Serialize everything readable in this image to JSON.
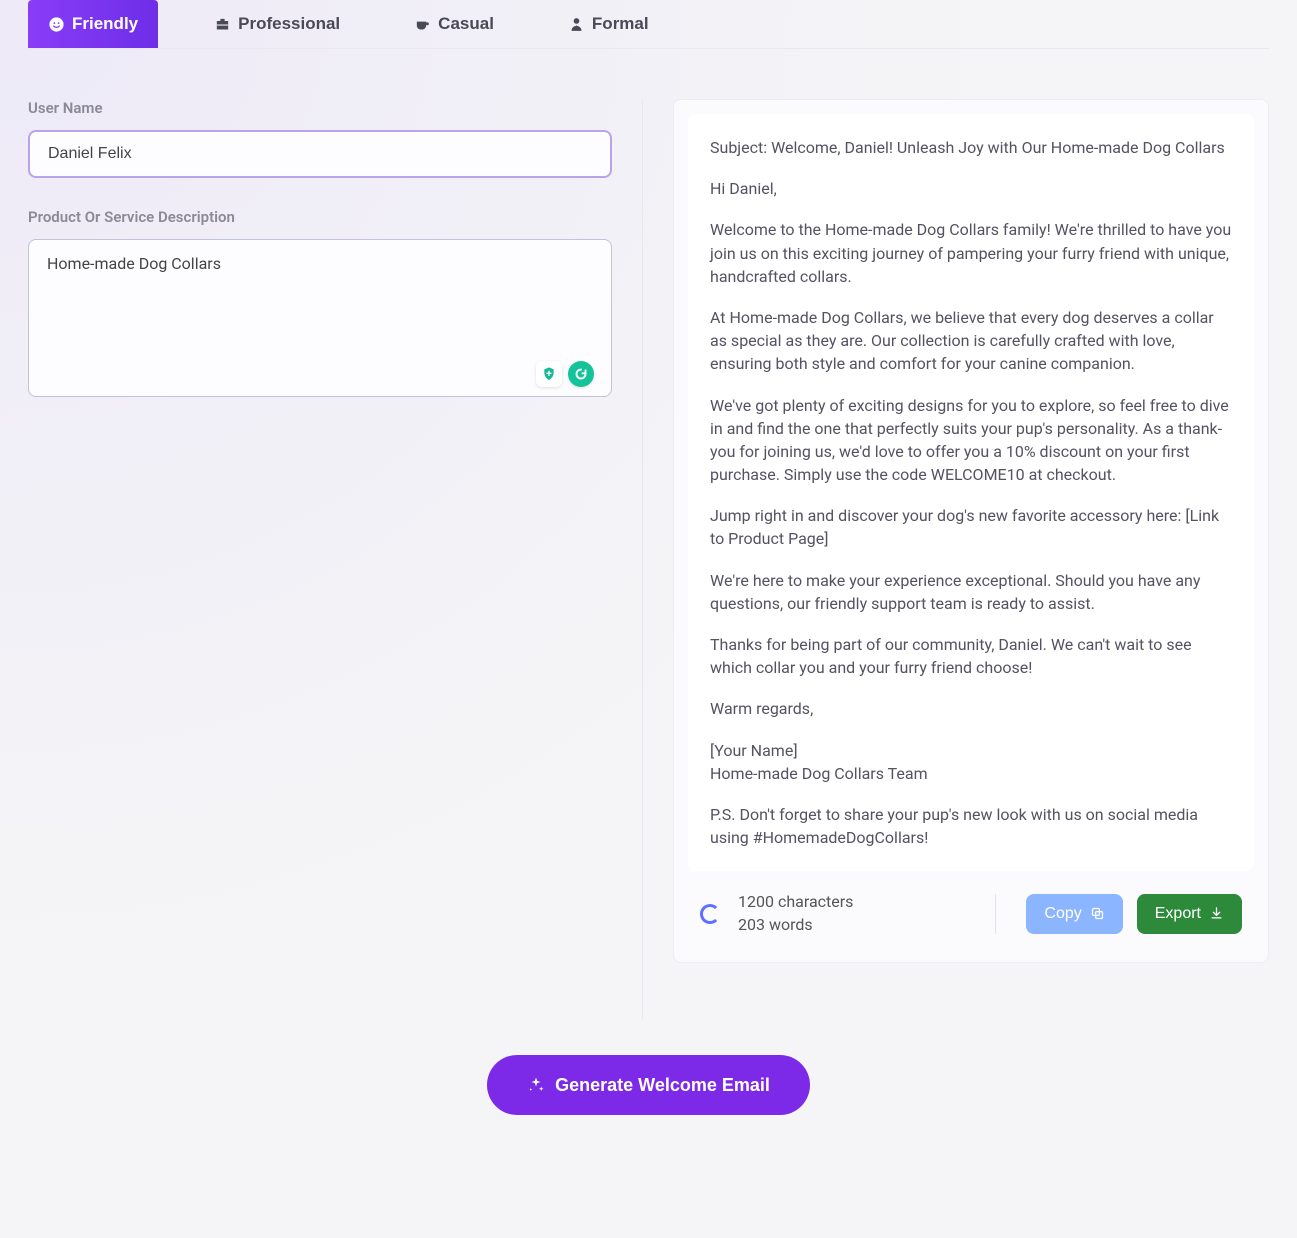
{
  "tabs": [
    {
      "label": "Friendly",
      "active": true
    },
    {
      "label": "Professional",
      "active": false
    },
    {
      "label": "Casual",
      "active": false
    },
    {
      "label": "Formal",
      "active": false
    }
  ],
  "form": {
    "user_name_label": "User Name",
    "user_name_value": "Daniel Felix",
    "product_label": "Product Or Service Description",
    "product_value": "Home-made Dog Collars"
  },
  "output": {
    "paragraphs": [
      "Subject: Welcome, Daniel! Unleash Joy with Our Home-made Dog Collars",
      "Hi Daniel,",
      "Welcome to the Home-made Dog Collars family! We're thrilled to have you join us on this exciting journey of pampering your furry friend with unique, handcrafted collars.",
      "At Home-made Dog Collars, we believe that every dog deserves a collar as special as they are. Our collection is carefully crafted with love, ensuring both style and comfort for your canine companion.",
      "We've got plenty of exciting designs for you to explore, so feel free to dive in and find the one that perfectly suits your pup's personality. As a thank-you for joining us, we'd love to offer you a 10% discount on your first purchase. Simply use the code WELCOME10 at checkout.",
      "Jump right in and discover your dog's new favorite accessory here: [Link to Product Page]",
      "We're here to make your experience exceptional. Should you have any questions, our friendly support team is ready to assist.",
      "Thanks for being part of our community, Daniel. We can't wait to see which collar you and your furry friend choose!",
      "Warm regards,",
      "[Your Name]\nHome-made Dog Collars Team",
      "P.S. Don't forget to share your pup's new look with us on social media using #HomemadeDogCollars!"
    ]
  },
  "stats": {
    "chars": "1200 characters",
    "words": "203 words"
  },
  "actions": {
    "copy": "Copy",
    "export": "Export",
    "generate": "Generate Welcome Email"
  }
}
